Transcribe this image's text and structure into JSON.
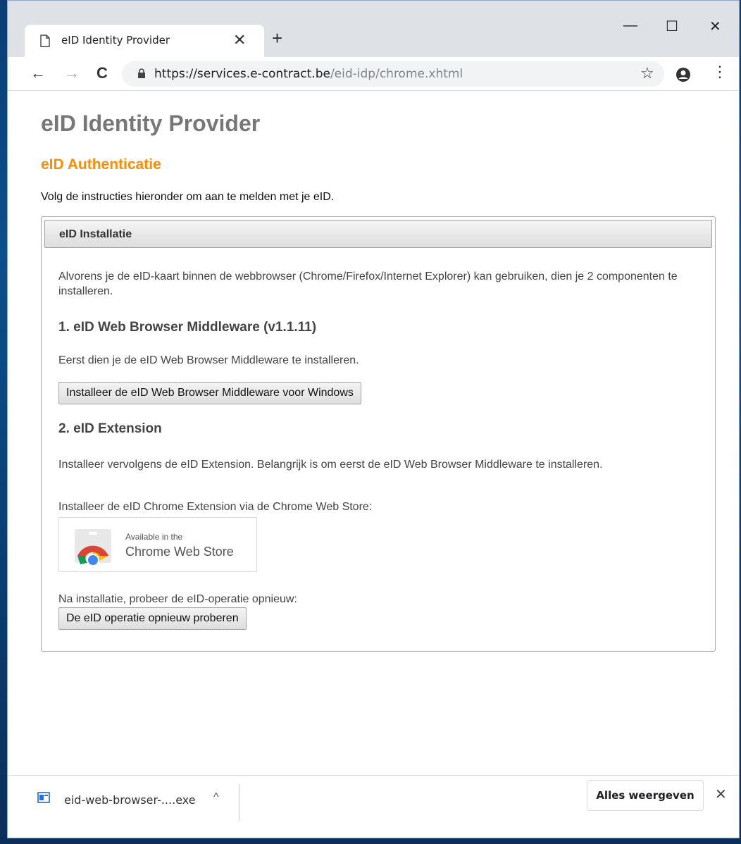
{
  "browser": {
    "tab_title": "eID Identity Provider",
    "tab_close": "✕",
    "new_tab": "+",
    "minimize": "—",
    "maximize": "☐",
    "close": "✕",
    "back": "←",
    "forward": "→",
    "reload": "C",
    "url_host": "https://services.e-contract.be",
    "url_path": "/eid-idp/chrome.xhtml",
    "star": "☆",
    "menu": "⋮"
  },
  "page": {
    "title": "eID Identity Provider",
    "subtitle": "eID Authenticatie",
    "intro": "Volg de instructies hieronder om aan te melden met je eID."
  },
  "panel": {
    "header": "eID Installatie",
    "para1": "Alvorens je de eID-kaart binnen de webbrowser (Chrome/Firefox/Internet Explorer) kan gebruiken, dien je 2 componenten te installeren.",
    "section1_title": "1. eID Web Browser Middleware (v1.1.11)",
    "section1_text": "Eerst dien je de eID Web Browser Middleware te installeren.",
    "section1_button": "Installeer de eID Web Browser Middleware voor Windows",
    "section2_title": "2. eID Extension",
    "section2_text": "Installeer vervolgens de eID Extension. Belangrijk is om eerst de eID Web Browser Middleware te installeren.",
    "store_text": "Installeer de eID Chrome Extension via de Chrome Web Store:",
    "store_badge_line1": "Available in the",
    "store_badge_line2": "Chrome Web Store",
    "retry_text": "Na installatie, probeer de eID-operatie opnieuw:",
    "retry_button": "De eID operatie opnieuw proberen"
  },
  "download_bar": {
    "filename": "eid-web-browser-....exe",
    "caret": "^",
    "show_all": "Alles weergeven",
    "close": "✕"
  },
  "colors": {
    "subtitle": "#ff8c00",
    "title": "#777777"
  }
}
